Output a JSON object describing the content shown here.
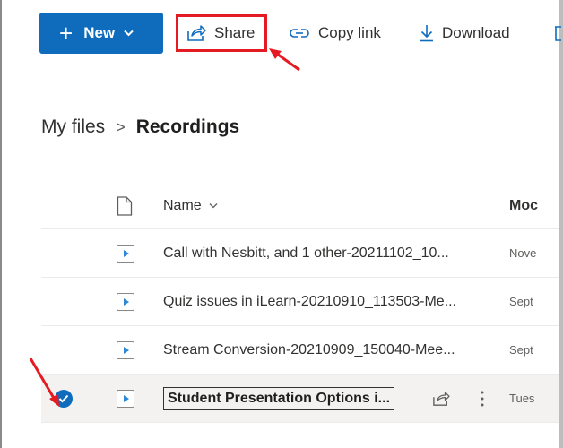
{
  "toolbar": {
    "new_label": "New",
    "share_label": "Share",
    "copy_link_label": "Copy link",
    "download_label": "Download"
  },
  "breadcrumb": {
    "root": "My files",
    "separator": ">",
    "current": "Recordings"
  },
  "list": {
    "columns": {
      "name": "Name",
      "modified": "Moc"
    },
    "rows": [
      {
        "name": "Call with Nesbitt, and 1 other-20211102_10...",
        "modified": "Nove",
        "selected": false
      },
      {
        "name": "Quiz issues in iLearn-20210910_113503-Me...",
        "modified": "Sept",
        "selected": false
      },
      {
        "name": "Stream Conversion-20210909_150040-Mee...",
        "modified": "Sept",
        "selected": false
      },
      {
        "name": "Student Presentation Options i...",
        "modified": "Tues",
        "selected": true
      }
    ]
  },
  "colors": {
    "accent": "#0f6cbd",
    "annotation": "#e41b23"
  },
  "icons": [
    "plus-icon",
    "chevron-down-icon",
    "share-icon",
    "link-icon",
    "download-icon",
    "trash-icon",
    "file-icon",
    "video-file-icon",
    "check-circle-icon",
    "more-vertical-icon"
  ]
}
